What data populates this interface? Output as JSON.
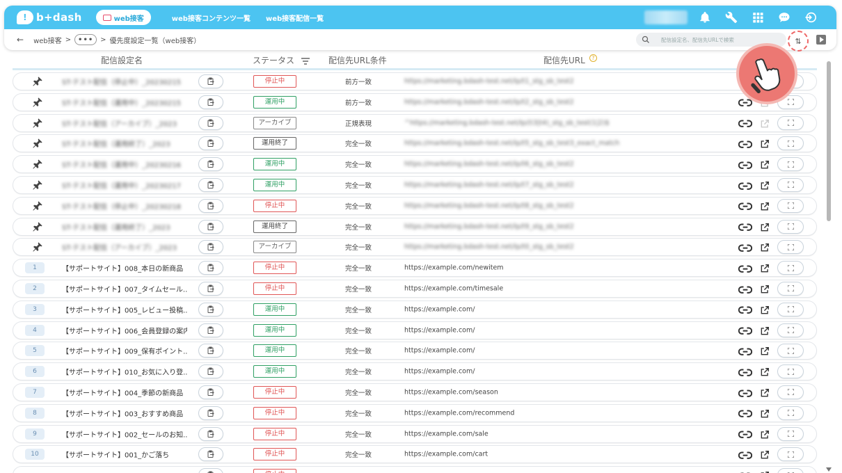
{
  "app": {
    "brand": "b+dash",
    "logo_mark": "!"
  },
  "nav": {
    "active": "web接客",
    "links": [
      "web接客コンテンツ一覧",
      "web接客配信一覧"
    ]
  },
  "breadcrumb": {
    "back": "←",
    "root": "web接客",
    "sep": ">",
    "more": "•••",
    "current": "優先度設定一覧（web接客）"
  },
  "search": {
    "placeholder": "配信設定名、配信先URLで検索"
  },
  "sort_icon": "⇅",
  "columns": {
    "name": "配信設定名",
    "status": "ステータス",
    "condition": "配信先URL条件",
    "url": "配信先URL",
    "help": "?"
  },
  "colors": {
    "accent": "#4cc4f1",
    "stop": "#e05555",
    "running": "#2e9f63"
  },
  "rows": [
    {
      "num": "",
      "pinned": true,
      "blur": true,
      "name": "ST-テスト配信（停止中）_20230215",
      "status": "停止中",
      "status_type": "stop",
      "condition": "前方一致",
      "url": "https://marketing.bdash-test.net/lp/t1_stg_sb_test2",
      "ext_dim": false
    },
    {
      "num": "",
      "pinned": true,
      "blur": true,
      "name": "ST-テスト配信（運用中）_20230215",
      "status": "運用中",
      "status_type": "run",
      "condition": "前方一致",
      "url": "https://marketing.bdash-test.net/lp/t2_stg_sb_test2",
      "ext_dim": true
    },
    {
      "num": "",
      "pinned": true,
      "blur": true,
      "name": "ST-テスト配信（アーカイブ）_2023",
      "status": "アーカイブ",
      "status_type": "arc",
      "condition": "正規表現",
      "url": "^https://marketing.bdash-test.net/lp/(t3|t4)_stg_sb_test(1|2)$",
      "ext_dim": true
    },
    {
      "num": "",
      "pinned": true,
      "blur": true,
      "name": "ST-テスト配信（運用終了）_2023",
      "status": "運用終了",
      "status_type": "end",
      "condition": "完全一致",
      "url": "https://marketing.bdash-test.net/lp/t5_stg_sb_test3_exact_match",
      "ext_dim": false
    },
    {
      "num": "",
      "pinned": true,
      "blur": true,
      "name": "ST-テスト配信（運用中）_20230216",
      "status": "運用中",
      "status_type": "run",
      "condition": "完全一致",
      "url": "https://marketing.bdash-test.net/lp/t6_stg_sb_test2",
      "ext_dim": false
    },
    {
      "num": "",
      "pinned": true,
      "blur": true,
      "name": "ST-テスト配信（運用中）_20230217",
      "status": "運用中",
      "status_type": "run",
      "condition": "完全一致",
      "url": "https://marketing.bdash-test.net/lp/t7_stg_sb_test2",
      "ext_dim": false
    },
    {
      "num": "",
      "pinned": true,
      "blur": true,
      "name": "ST-テスト配信（停止中）_20230218",
      "status": "停止中",
      "status_type": "stop",
      "condition": "完全一致",
      "url": "https://marketing.bdash-test.net/lp/t8_stg_sb_test2",
      "ext_dim": false
    },
    {
      "num": "",
      "pinned": true,
      "blur": true,
      "name": "ST-テスト配信（運用終了）_2023",
      "status": "運用終了",
      "status_type": "end",
      "condition": "完全一致",
      "url": "https://marketing.bdash-test.net/lp/t9_stg_sb_test2",
      "ext_dim": false
    },
    {
      "num": "",
      "pinned": true,
      "blur": true,
      "name": "ST-テスト配信（アーカイブ）_2023",
      "status": "アーカイブ",
      "status_type": "arc",
      "condition": "完全一致",
      "url": "https://marketing.bdash-test.net/lp/t0_stg_sb_test2",
      "ext_dim": false
    },
    {
      "num": "1",
      "pinned": false,
      "blur": false,
      "name": "【サポートサイト】008_本日の新商品",
      "status": "停止中",
      "status_type": "stop",
      "condition": "完全一致",
      "url": "https://example.com/newitem",
      "ext_dim": false
    },
    {
      "num": "2",
      "pinned": false,
      "blur": false,
      "name": "【サポートサイト】007_タイムセール...",
      "status": "停止中",
      "status_type": "stop",
      "condition": "完全一致",
      "url": "https://example.com/timesale",
      "ext_dim": false
    },
    {
      "num": "3",
      "pinned": false,
      "blur": false,
      "name": "【サポートサイト】005_レビュー投稿...",
      "status": "運用中",
      "status_type": "run",
      "condition": "完全一致",
      "url": "https://example.com/",
      "ext_dim": false
    },
    {
      "num": "4",
      "pinned": false,
      "blur": false,
      "name": "【サポートサイト】006_会員登録の案内",
      "status": "運用中",
      "status_type": "run",
      "condition": "完全一致",
      "url": "https://example.com/",
      "ext_dim": false
    },
    {
      "num": "5",
      "pinned": false,
      "blur": false,
      "name": "【サポートサイト】009_保有ポイント...",
      "status": "運用中",
      "status_type": "run",
      "condition": "完全一致",
      "url": "https://example.com/",
      "ext_dim": false
    },
    {
      "num": "6",
      "pinned": false,
      "blur": false,
      "name": "【サポートサイト】010_お気に入り登...",
      "status": "運用中",
      "status_type": "run",
      "condition": "完全一致",
      "url": "https://example.com/",
      "ext_dim": false
    },
    {
      "num": "7",
      "pinned": false,
      "blur": false,
      "name": "【サポートサイト】004_季節の新商品",
      "status": "停止中",
      "status_type": "stop",
      "condition": "完全一致",
      "url": "https://example.com/season",
      "ext_dim": false
    },
    {
      "num": "8",
      "pinned": false,
      "blur": false,
      "name": "【サポートサイト】003_おすすめ商品",
      "status": "停止中",
      "status_type": "stop",
      "condition": "完全一致",
      "url": "https://example.com/recommend",
      "ext_dim": false
    },
    {
      "num": "9",
      "pinned": false,
      "blur": false,
      "name": "【サポートサイト】002_セールのお知...",
      "status": "停止中",
      "status_type": "stop",
      "condition": "完全一致",
      "url": "https://example.com/sale",
      "ext_dim": false
    },
    {
      "num": "10",
      "pinned": false,
      "blur": false,
      "name": "【サポートサイト】001_かご落ち",
      "status": "停止中",
      "status_type": "stop",
      "condition": "完全一致",
      "url": "https://example.com/cart",
      "ext_dim": false
    },
    {
      "num": "",
      "pinned": false,
      "blur": false,
      "name": "",
      "status": "停止中",
      "status_type": "stop",
      "condition": "",
      "url": "",
      "ext_dim": false
    }
  ],
  "icons": {
    "pin": "pin-icon",
    "clip": "clipboard-icon",
    "link": "link-icon",
    "ext": "external-link-icon",
    "full": "fullscreen-icon"
  }
}
